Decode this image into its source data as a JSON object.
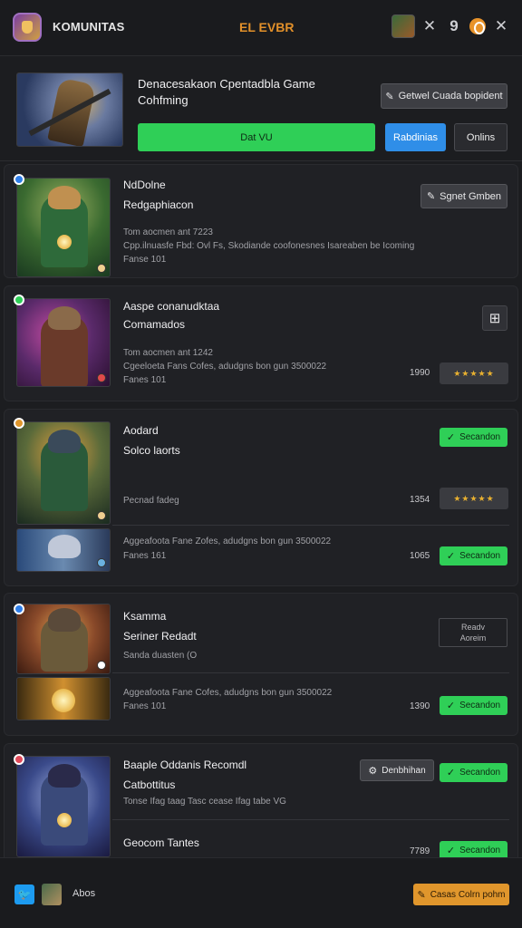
{
  "header": {
    "app_title": "KOMUNITAS",
    "center_title": "EL EVBR",
    "x_icon": "✕",
    "nine_icon": "9",
    "close_icon": "✕"
  },
  "hero": {
    "title": "Denacesakaon Cpentadbla Game Cohfming",
    "top_button": "Getwel Cuada bopident",
    "green_button": "Dat VU",
    "blue_button": "Rabdinias",
    "dark_button": "Onlins"
  },
  "cards": [
    {
      "title": "NdDolne",
      "subtitle": "Redgaphiacon",
      "line1": "Tom aocmen ant 7223",
      "line2": "Cpp.ilnuasfe Fbd: Ovl Fs, Skodiande coofonesnes Isareaben be Icoming",
      "line3": "Fanse 101",
      "button": "Sgnet Gmben",
      "badge_color": "#2f7ee8"
    },
    {
      "title": "Aaspe conanudktaa",
      "subtitle": "Comamados",
      "line1": "Tom aocmen ant 1242",
      "line2": "Cgeeloeta Fans Cofes, adudgns bon gun 3500022",
      "line3": "Fanes 101",
      "num": "1990",
      "stars": "★★★★★",
      "badge_color": "#2fcf57"
    },
    {
      "title": "Aodard",
      "subtitle": "Solco laorts",
      "line1": "Pecnad fadeg",
      "line2": "Aggeafoota Fane Zofes, adudgns bon gun 3500022",
      "line3": "Fanes 161",
      "num1": "1354",
      "num2": "1065",
      "stars": "★★★★★",
      "btn1": "Secandon",
      "btn2": "Secandon",
      "badge_color": "#e0962c"
    },
    {
      "title": "Ksamma",
      "subtitle": "Seriner Redadt",
      "line1": "Sanda duasten (O",
      "line2": "Aggeafoota Fane Cofes, adudgns bon gun 3500022",
      "line3": "Fanes 101",
      "num": "1390",
      "box_line1": "Readv",
      "box_line2": "Aoreim",
      "btn": "Secandon",
      "badge_color": "#2f7ee8"
    },
    {
      "title": "Baaple Oddanis Recomdl",
      "subtitle": "Catbottitus",
      "line1": "Tonse Ifag taag Tasc cease Ifag tabe VG",
      "line2": "Geocom Tantes",
      "num": "7789",
      "btn_outline": "Denbhihan",
      "btn1": "Secandon",
      "btn2": "Secandon",
      "badge_color": "#e04a5a"
    }
  ],
  "footer": {
    "label": "Abos",
    "cta": "Casas Colrn pohm"
  }
}
